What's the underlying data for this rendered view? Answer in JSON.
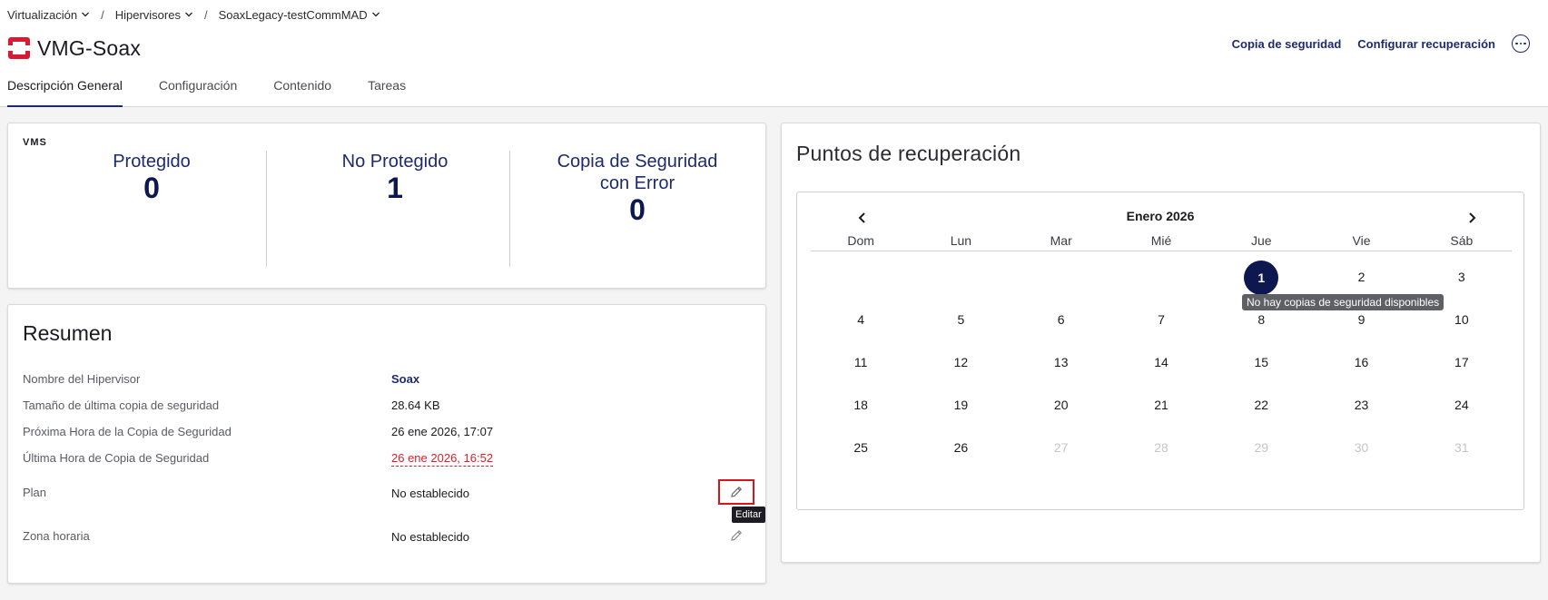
{
  "breadcrumb": {
    "items": [
      "Virtualización",
      "Hipervisores",
      "SoaxLegacy-testCommMAD"
    ],
    "separator": "/"
  },
  "header": {
    "title": "VMG-Soax",
    "logo_icon": "openstack-logo-icon",
    "actions": {
      "backup": "Copia de seguridad",
      "configure_recovery": "Configurar recuperación"
    },
    "more_icon": "more-icon"
  },
  "tabs": [
    "Descripción General",
    "Configuración",
    "Contenido",
    "Tareas"
  ],
  "vms": {
    "label": "VMS",
    "stats": [
      {
        "label": "Protegido",
        "value": "0"
      },
      {
        "label": "No Protegido",
        "value": "1"
      },
      {
        "label": "Copia de Seguridad con Error",
        "value": "0"
      }
    ]
  },
  "resumen": {
    "title": "Resumen",
    "rows": [
      {
        "key": "Nombre del Hipervisor",
        "value": "Soax"
      },
      {
        "key": "Tamaño de última copia de seguridad",
        "value": "28.64 KB"
      },
      {
        "key": "Próxima Hora de la Copia de Seguridad",
        "value": "26 ene 2026, 17:07"
      },
      {
        "key": "Última Hora de Copia de Seguridad",
        "value": "26 ene 2026, 16:52"
      },
      {
        "key": "Plan",
        "value": "No establecido"
      },
      {
        "key": "Zona horaria",
        "value": "No establecido"
      }
    ],
    "edit_tooltip": "Editar"
  },
  "recovery": {
    "title": "Puntos de recuperación",
    "month": "Enero 2026",
    "weekdays": [
      "Dom",
      "Lun",
      "Mar",
      "Mié",
      "Jue",
      "Vie",
      "Sáb"
    ],
    "weeks": [
      [
        "",
        "",
        "",
        "",
        "1",
        "2",
        "3"
      ],
      [
        "4",
        "5",
        "6",
        "7",
        "8",
        "9",
        "10"
      ],
      [
        "11",
        "12",
        "13",
        "14",
        "15",
        "16",
        "17"
      ],
      [
        "18",
        "19",
        "20",
        "21",
        "22",
        "23",
        "24"
      ],
      [
        "25",
        "26",
        "27",
        "28",
        "29",
        "30",
        "31"
      ]
    ],
    "tooltip": "No hay copias de seguridad disponibles"
  },
  "colors": {
    "accent": "#1e2a6e",
    "selected": "#0d1750",
    "error": "#d8202a",
    "logo": "#da1a32"
  }
}
